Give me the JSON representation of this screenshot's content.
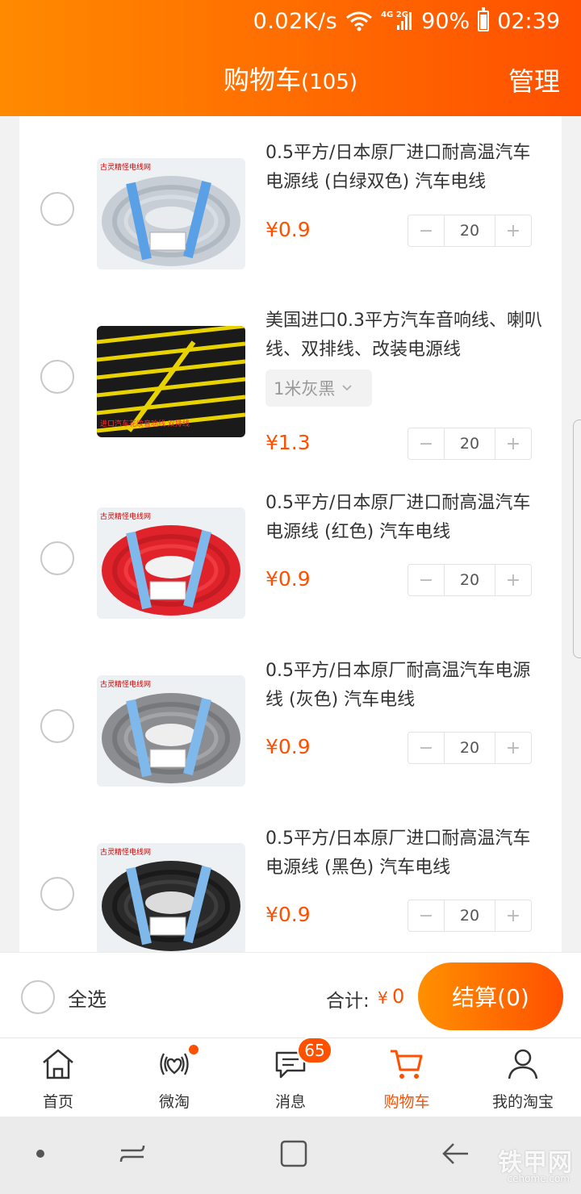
{
  "status_bar": {
    "net_speed": "0.02K/s",
    "net_types": "4G 2G",
    "battery": "90%",
    "time": "02:39"
  },
  "header": {
    "title": "购物车",
    "count": "(105)",
    "manage_label": "管理"
  },
  "cart": {
    "items": [
      {
        "title": "0.5平方/日本原厂进口耐高温汽车电源线 (白绿双色) 汽车电线",
        "currency": "¥",
        "price": "0.9",
        "quantity": "20",
        "image_label": "古灵精怪电线网",
        "image_color": "#c7ced6"
      },
      {
        "title": "美国进口0.3平方汽车音响线、喇叭线、双排线、改装电源线",
        "sku": "1米灰黑",
        "currency": "¥",
        "price": "1.3",
        "quantity": "20",
        "image_label": "进口汽车花纹音响线 双排线",
        "image_color": "#1e1e1e"
      },
      {
        "title": "0.5平方/日本原厂进口耐高温汽车电源线 (红色) 汽车电线",
        "currency": "¥",
        "price": "0.9",
        "quantity": "20",
        "image_label": "古灵精怪电线网",
        "image_color": "#e0232b"
      },
      {
        "title": "0.5平方/日本原厂耐高温汽车电源线 (灰色) 汽车电线",
        "currency": "¥",
        "price": "0.9",
        "quantity": "20",
        "image_label": "古灵精怪电线网",
        "image_color": "#8b8d90"
      },
      {
        "title": "0.5平方/日本原厂进口耐高温汽车电源线 (黑色) 汽车电线",
        "currency": "¥",
        "price": "0.9",
        "quantity": "20",
        "image_label": "古灵精怪电线网",
        "image_color": "#2a2a2a"
      }
    ],
    "minus_symbol": "−",
    "plus_symbol": "+"
  },
  "summary": {
    "select_all_label": "全选",
    "total_label": "合计:",
    "total_currency": "¥",
    "total_value": "0",
    "checkout_label": "结算(0)"
  },
  "tabbar": {
    "tabs": [
      {
        "label": "首页",
        "icon": "home-icon"
      },
      {
        "label": "微淘",
        "icon": "broadcast-heart-icon"
      },
      {
        "label": "消息",
        "icon": "message-icon",
        "badge": "65"
      },
      {
        "label": "购物车",
        "icon": "cart-icon",
        "active": true
      },
      {
        "label": "我的淘宝",
        "icon": "user-icon"
      }
    ]
  },
  "watermark": {
    "text": "铁甲网",
    "sub": "cehome.com"
  },
  "colors": {
    "accent": "#ff5000",
    "header_start": "#ff8a00",
    "header_end": "#ff5000"
  }
}
